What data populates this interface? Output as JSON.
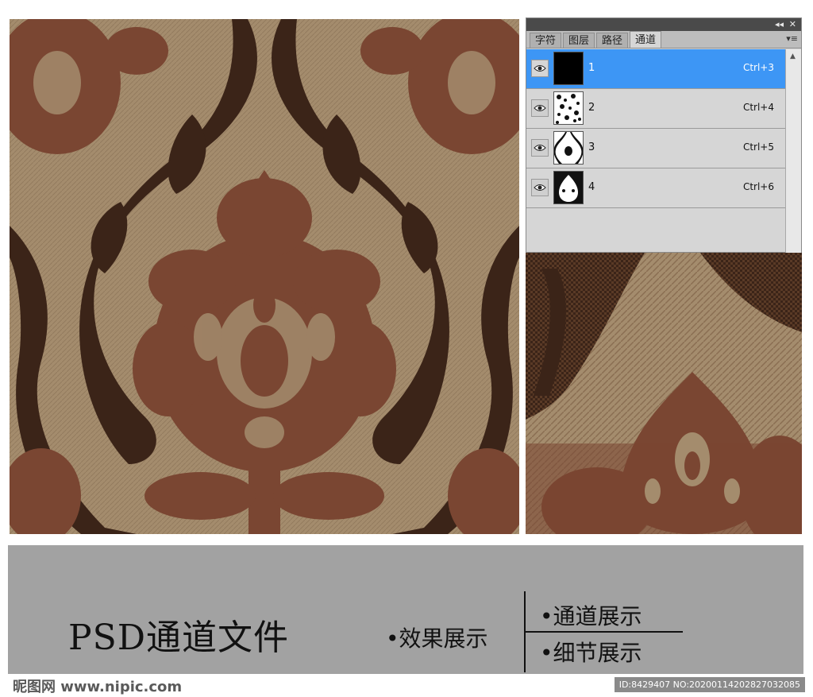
{
  "colors": {
    "background_tan": "#a48c6d",
    "rust_motif": "#7a4632",
    "dark_scroll": "#3b2418",
    "panel_select": "#3d96f5",
    "banner_gray": "#a2a2a2"
  },
  "panel": {
    "tabs": [
      {
        "label": "字符"
      },
      {
        "label": "图层"
      },
      {
        "label": "路径"
      },
      {
        "label": "通道"
      }
    ],
    "active_tab": "通道",
    "channels": [
      {
        "name": "1",
        "shortcut": "Ctrl+3",
        "visible_icon": "eye-icon"
      },
      {
        "name": "2",
        "shortcut": "Ctrl+4",
        "visible_icon": "eye-icon"
      },
      {
        "name": "3",
        "shortcut": "Ctrl+5",
        "visible_icon": "eye-icon"
      },
      {
        "name": "4",
        "shortcut": "Ctrl+6",
        "visible_icon": "eye-icon"
      }
    ],
    "titlebar_buttons": [
      "collapse-icon",
      "close-icon"
    ],
    "collapse_glyph": "◂◂",
    "close_glyph": "✕",
    "menu_glyph": "▾≡",
    "scroll_glyph": "▲"
  },
  "banner": {
    "title": "PSD通道文件",
    "effect_label": "•效果展示",
    "channels_label": "•通道展示",
    "detail_label": "•细节展示"
  },
  "footer": {
    "watermark": "昵图网 www.nipic.com",
    "image_id": "ID:8429407 NO:20200114202827032085"
  }
}
